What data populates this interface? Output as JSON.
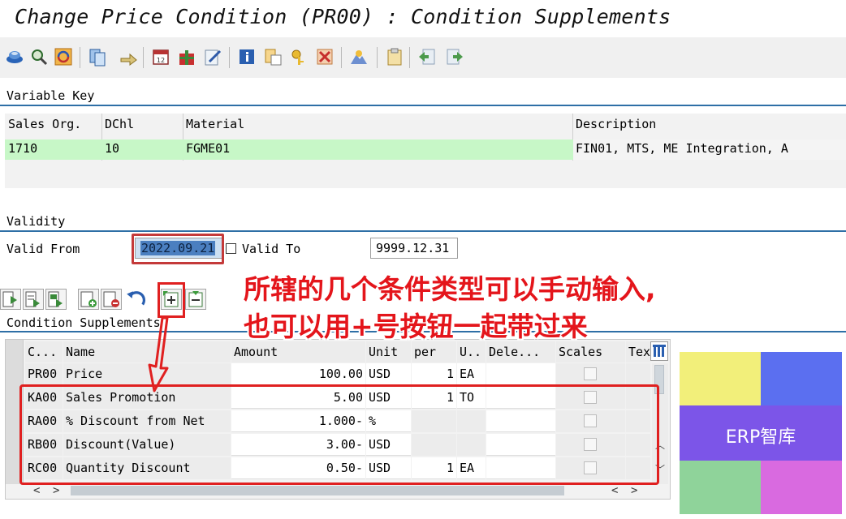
{
  "window": {
    "title": "Change Price Condition (PR00) : Condition Supplements"
  },
  "toolbar": {
    "icons": [
      "save-icon",
      "find-icon",
      "refresh-icon",
      "copy-records-icon",
      "forward-icon",
      "calendar-icon",
      "gift-icon",
      "edit-icon",
      "info-icon",
      "table-icon",
      "key-icon",
      "delete-icon",
      "mountain-icon",
      "paste-icon",
      "previous-icon",
      "next-icon"
    ]
  },
  "variable_key": {
    "section_label": "Variable Key",
    "columns": [
      "Sales Org.",
      "DChl",
      "Material",
      "Description"
    ],
    "row": {
      "sales_org": "1710",
      "dchl": "10",
      "material": "FGME01",
      "description": "FIN01, MTS, ME Integration, A"
    }
  },
  "validity": {
    "section_label": "Validity",
    "valid_from_label": "Valid From",
    "valid_from_value": "2022.09.21",
    "valid_to_label": "Valid To",
    "valid_to_value": "9999.12.31"
  },
  "condition_supplements": {
    "section_label": "Condition Supplements",
    "columns": [
      "C...",
      "Name",
      "Amount",
      "Unit",
      "per",
      "U..",
      "Dele...",
      "Scales",
      "Tex"
    ],
    "rows": [
      {
        "ctype": "PR00",
        "name": "Price",
        "amount": "100.00",
        "unit": "USD",
        "per": "1",
        "uom": "EA"
      },
      {
        "ctype": "KA00",
        "name": "Sales Promotion",
        "amount": "5.00",
        "unit": "USD",
        "per": "1",
        "uom": "TO"
      },
      {
        "ctype": "RA00",
        "name": "% Discount from Net",
        "amount": "1.000-",
        "unit": "%",
        "per": "",
        "uom": ""
      },
      {
        "ctype": "RB00",
        "name": "Discount(Value)",
        "amount": "3.00-",
        "unit": "USD",
        "per": "",
        "uom": ""
      },
      {
        "ctype": "RC00",
        "name": "Quantity Discount",
        "amount": "0.50-",
        "unit": "USD",
        "per": "1",
        "uom": "EA"
      }
    ]
  },
  "annotation": {
    "line1": "所辖的几个条件类型可以手动输入,",
    "line2": "也可以用+号按钮一起带过来"
  },
  "watermark": {
    "text": "ERP智库",
    "colors": [
      "#f2ef7a",
      "#5b6ff0",
      "#8fd39a",
      "#d96ae0"
    ]
  }
}
